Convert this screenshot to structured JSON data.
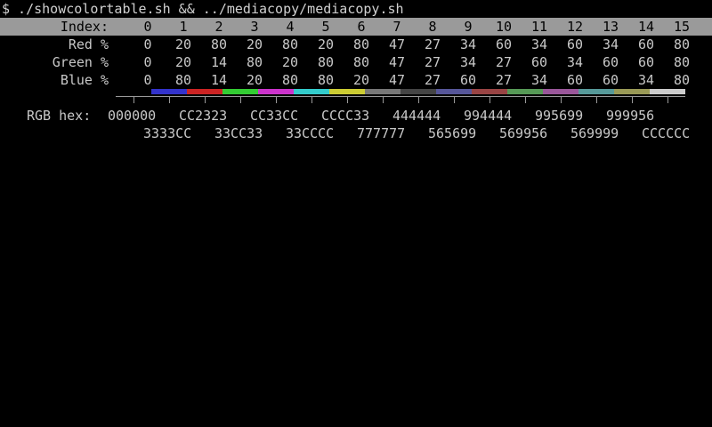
{
  "terminal": {
    "prompt": "$ ./showcolortable.sh && ../mediacopy/mediacopy.sh"
  },
  "table": {
    "index_label": "Index:",
    "red_label": "Red %",
    "green_label": "Green %",
    "blue_label": "Blue %",
    "indices": [
      "0",
      "1",
      "2",
      "3",
      "4",
      "5",
      "6",
      "7",
      "8",
      "9",
      "10",
      "11",
      "12",
      "13",
      "14",
      "15"
    ],
    "red": [
      "0",
      "20",
      "80",
      "20",
      "80",
      "20",
      "80",
      "47",
      "27",
      "34",
      "60",
      "34",
      "60",
      "34",
      "60",
      "80"
    ],
    "green": [
      "0",
      "20",
      "14",
      "80",
      "20",
      "80",
      "80",
      "47",
      "27",
      "34",
      "27",
      "60",
      "34",
      "60",
      "60",
      "80"
    ],
    "blue": [
      "0",
      "80",
      "14",
      "20",
      "80",
      "80",
      "20",
      "47",
      "27",
      "60",
      "27",
      "34",
      "60",
      "60",
      "34",
      "80"
    ],
    "swatch_colors": [
      "#000000",
      "#3333CC",
      "#CC2323",
      "#33CC33",
      "#CC33CC",
      "#33CCCC",
      "#CCCC33",
      "#777777",
      "#444444",
      "#565699",
      "#994444",
      "#569956",
      "#995699",
      "#569999",
      "#999956",
      "#CCCCCC"
    ]
  },
  "hex": {
    "label": "RGB hex:",
    "row1": [
      "000000",
      "CC2323",
      "CC33CC",
      "CCCC33",
      "444444",
      "994444",
      "995699",
      "999956"
    ],
    "row2": [
      "3333CC",
      "33CC33",
      "33CCCC",
      "777777",
      "565699",
      "569956",
      "569999",
      "CCCCCC"
    ]
  }
}
